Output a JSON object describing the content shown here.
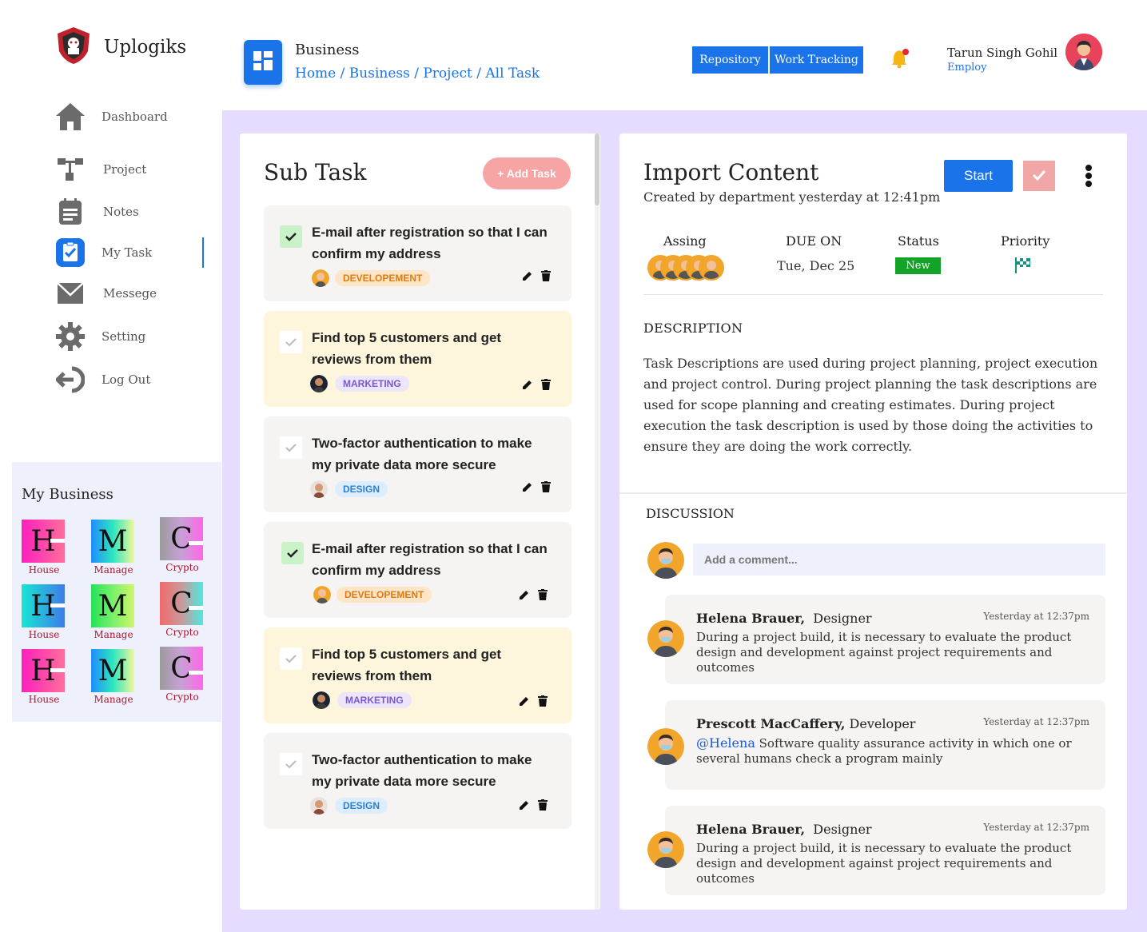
{
  "brand": {
    "name": "Uplogiks"
  },
  "sidebar": {
    "items": [
      {
        "label": "Dashboard",
        "icon": "home-icon"
      },
      {
        "label": "Project",
        "icon": "project-tree-icon"
      },
      {
        "label": "Notes",
        "icon": "notes-icon"
      },
      {
        "label": "My Task",
        "icon": "task-clipboard-icon",
        "active": true
      },
      {
        "label": "Messege",
        "icon": "mail-icon"
      },
      {
        "label": "Setting",
        "icon": "gear-icon"
      },
      {
        "label": "Log Out",
        "icon": "logout-icon"
      }
    ]
  },
  "my_business": {
    "title": "My Business",
    "items": [
      {
        "letter": "H",
        "label": "House"
      },
      {
        "letter": "M",
        "label": "Manage"
      },
      {
        "letter": "C",
        "label": "Crypto"
      },
      {
        "letter": "H",
        "label": "House"
      },
      {
        "letter": "M",
        "label": "Manage"
      },
      {
        "letter": "C",
        "label": "Crypto"
      },
      {
        "letter": "H",
        "label": "House"
      },
      {
        "letter": "M",
        "label": "Manage"
      },
      {
        "letter": "C",
        "label": "Crypto"
      }
    ]
  },
  "header": {
    "title": "Business",
    "breadcrumb": "Home / Business /  Project / All Task",
    "buttons": {
      "repository": "Repository",
      "work_tracking": "Work Tracking"
    },
    "user": {
      "name": "Tarun Singh Gohil",
      "role": "Employ"
    }
  },
  "subtask": {
    "title": "Sub Task",
    "add_label": "+ Add Task",
    "cards": [
      {
        "title": "E-mail after registration so that I can confirm my address",
        "tag": "DEVELOPEMENT",
        "done": true
      },
      {
        "title": "Find top 5 customers and get reviews from them",
        "tag": "MARKETING",
        "done": false
      },
      {
        "title": "Two-factor authentication to make my private data more secure",
        "tag": "DESIGN",
        "done": false
      },
      {
        "title": "E-mail after registration so that I can confirm my address",
        "tag": "DEVELOPEMENT",
        "done": true
      },
      {
        "title": "Find top 5 customers and get reviews from them",
        "tag": "MARKETING",
        "done": false
      },
      {
        "title": "Two-factor authentication to make my private data more secure",
        "tag": "DESIGN",
        "done": false
      }
    ]
  },
  "detail": {
    "title": "Import Content",
    "subtitle": "Created by department yesterday at 12:41pm",
    "start_label": "Start",
    "meta": {
      "assign_label": "Assing",
      "due_label": "DUE ON",
      "due_value": "Tue, Dec 25",
      "status_label": "Status",
      "status_value": "New",
      "priority_label": "Priority"
    },
    "description_heading": "DESCRIPTION",
    "description": "Task Descriptions are used during project planning, project execution and project control. During project planning the task descriptions are used for scope planning and creating estimates. During project execution the task description is used by those doing the activities to ensure they are doing the work correctly.",
    "discussion_heading": "DISCUSSION",
    "comment_placeholder": "Add a comment...",
    "comments": [
      {
        "name": "Helena Brauer,",
        "role": "Designer",
        "time": "Yesterday at 12:37pm",
        "mention": "",
        "text": "During a project build, it is necessary to evaluate the product design and development against project requirements and outcomes"
      },
      {
        "name": "Prescott MacCaffery,",
        "role": "Developer",
        "time": "Yesterday at 12:37pm",
        "mention": "@Helena",
        "text": "Software quality assurance activity in which one or several humans check a program mainly"
      },
      {
        "name": "Helena Brauer,",
        "role": "Designer",
        "time": "Yesterday at 12:37pm",
        "mention": "",
        "text": "During a project build, it is necessary to evaluate the product design and development against project requirements and outcomes"
      }
    ]
  },
  "colors": {
    "accent": "#1a73e8",
    "panel_bg": "#e5dcff",
    "status_new": "#14a229",
    "add_task": "#f7a4a4"
  }
}
